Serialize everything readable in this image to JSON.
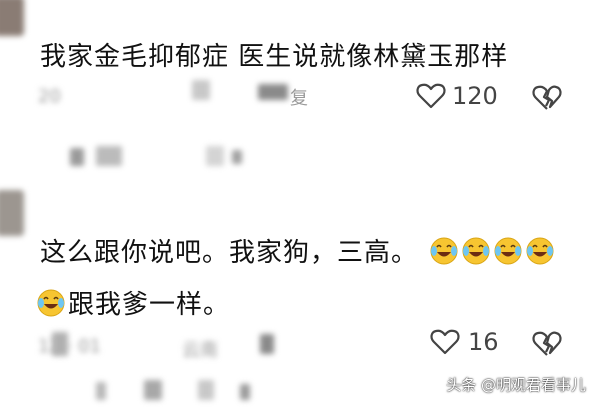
{
  "comments": [
    {
      "text": "我家金毛抑郁症   医生说就像林黛玉那样",
      "meta": "20",
      "meta_suffix": "复",
      "likes": "120",
      "like_icon": "heart-outline-icon",
      "dislike_icon": "broken-heart-icon"
    },
    {
      "text_line1": "这么跟你说吧。我家狗，三高。",
      "text_line2": "跟我爹一样。",
      "meta": "12 · 01",
      "meta_suffix": "云南",
      "likes": "16",
      "like_icon": "heart-outline-icon",
      "dislike_icon": "broken-heart-icon",
      "emoji": "laughing-crying-emoji"
    }
  ],
  "watermark": "头条 @明观君看事儿",
  "colors": {
    "text": "#111111",
    "meta": "#9a9a9a",
    "icon": "#444444",
    "emoji_face": "#f7c531"
  }
}
